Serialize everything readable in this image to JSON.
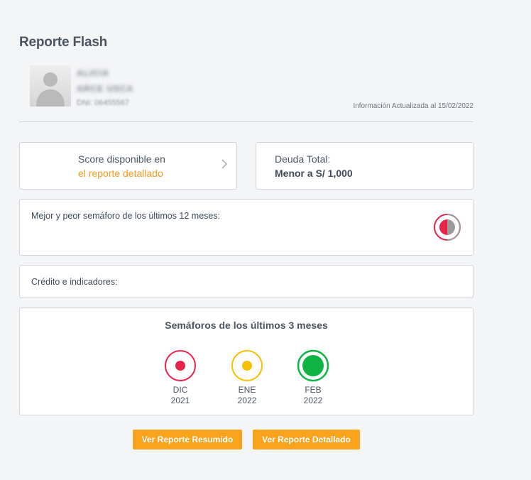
{
  "header": {
    "title": "Reporte Flash"
  },
  "profile": {
    "name_line1": "ALICIA",
    "name_line2": "ARCE USCA",
    "dni_label": "DNI",
    "dni_value": "06455567",
    "avatar_icon": "user-avatar-icon"
  },
  "updated_text": "Información Actualizada al 15/02/2022",
  "score_card": {
    "line1": "Score disponible en",
    "line2": "el reporte detallado",
    "accent_color": "#f59a1a",
    "icon": "chevron-right-icon"
  },
  "debt_card": {
    "label": "Deuda Total:",
    "value": "Menor a S/ 1,000"
  },
  "best_worst": {
    "label": "Mejor y peor semáforo de los últimos 12 meses:",
    "icon": "half-red-gray-semaphore-icon"
  },
  "credit": {
    "label": "Crédito e indicadores:"
  },
  "last_months": {
    "title": "Semáforos de los últimos 3 meses",
    "months": [
      {
        "name": "DIC",
        "year": "2021",
        "color": "#e8224b",
        "size": "small"
      },
      {
        "name": "ENE",
        "year": "2022",
        "color": "#f6c000",
        "size": "small"
      },
      {
        "name": "FEB",
        "year": "2022",
        "color": "#10b444",
        "size": "large"
      }
    ]
  },
  "buttons": {
    "summary": "Ver Reporte Resumido",
    "detailed": "Ver Reporte Detallado",
    "color": "#f9a31b"
  }
}
